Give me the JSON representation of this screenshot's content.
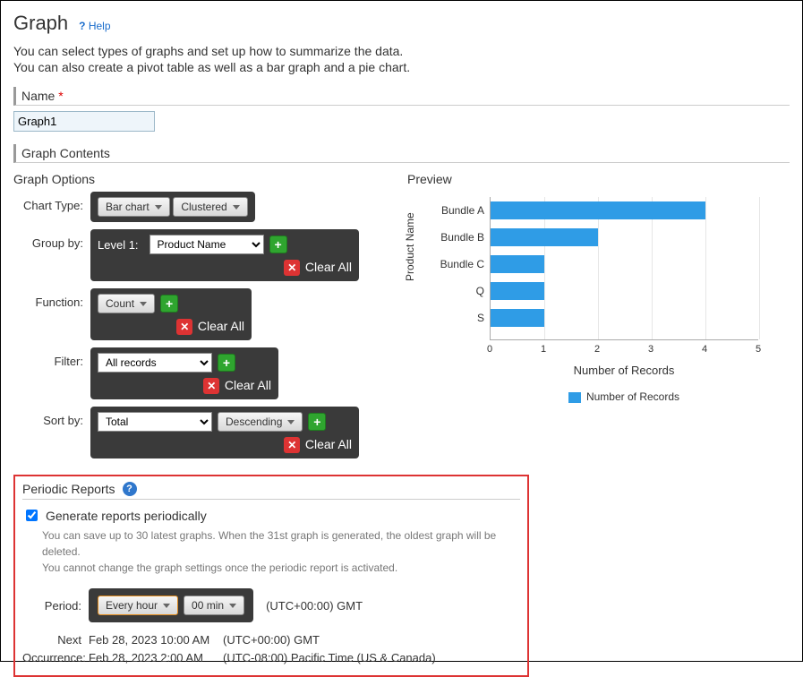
{
  "page_title": "Graph",
  "help_label": "Help",
  "intro_line1": "You can select types of graphs and set up how to summarize the data.",
  "intro_line2": "You can also create a pivot table as well as a bar graph and a pie chart.",
  "name_section": "Name",
  "name_value": "Graph1",
  "contents_section": "Graph Contents",
  "graph_options_title": "Graph Options",
  "preview_title": "Preview",
  "labels": {
    "chart_type": "Chart Type:",
    "group_by": "Group by:",
    "function": "Function:",
    "filter": "Filter:",
    "sort_by": "Sort by:"
  },
  "chart_type": {
    "main": "Bar chart",
    "sub": "Clustered"
  },
  "group_by": {
    "level_label": "Level 1:",
    "value": "Product Name"
  },
  "function_value": "Count",
  "filter_value": "All records",
  "sort_main": "Total",
  "sort_dir": "Descending",
  "clear_all": "Clear All",
  "periodic": {
    "header": "Periodic Reports",
    "checkbox_label": "Generate reports periodically",
    "hint1": "You can save up to 30 latest graphs. When the 31st graph is generated, the oldest graph will be deleted.",
    "hint2": "You cannot change the graph settings once the periodic report is activated.",
    "period_label": "Period:",
    "period_freq": "Every hour",
    "period_min": "00 min",
    "tz": "(UTC+00:00) GMT",
    "next_label_1": "Next",
    "next_label_2": "Occurrence:",
    "occ1_dt": "Feb 28, 2023 10:00 AM",
    "occ1_tz": "(UTC+00:00) GMT",
    "occ2_dt": "Feb 28, 2023 2:00 AM",
    "occ2_tz": "(UTC-08:00) Pacific Time (US & Canada)"
  },
  "chart_data": {
    "type": "bar",
    "orientation": "horizontal",
    "categories": [
      "Bundle A",
      "Bundle B",
      "Bundle C",
      "Q",
      "S"
    ],
    "values": [
      4,
      2,
      1,
      1,
      1
    ],
    "ylabel": "Product Name",
    "xlabel": "Number of Records",
    "xlim": [
      0,
      5
    ],
    "legend": "Number of Records"
  }
}
